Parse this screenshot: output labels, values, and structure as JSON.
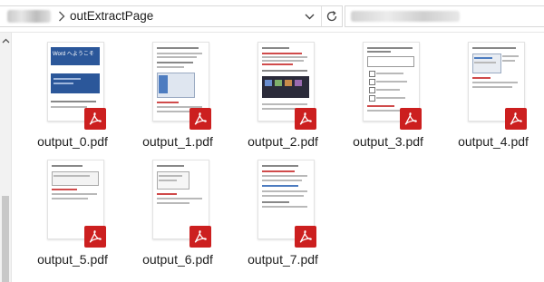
{
  "address_bar": {
    "current_folder": "outExtractPage",
    "separator_icon": "chevron-right-icon",
    "dropdown_icon": "chevron-down-icon",
    "refresh_icon": "refresh-icon"
  },
  "search": {
    "placeholder": ""
  },
  "scroll_icon": "chevron-up-icon",
  "file_icon": "pdf-icon",
  "files": [
    {
      "name": "output_0.pdf",
      "thumb_title": "Word へようこそ"
    },
    {
      "name": "output_1.pdf"
    },
    {
      "name": "output_2.pdf"
    },
    {
      "name": "output_3.pdf"
    },
    {
      "name": "output_4.pdf"
    },
    {
      "name": "output_5.pdf"
    },
    {
      "name": "output_6.pdf"
    },
    {
      "name": "output_7.pdf"
    }
  ],
  "colors": {
    "pdf_badge": "#cc1f1f",
    "word_blue": "#2b579a"
  }
}
